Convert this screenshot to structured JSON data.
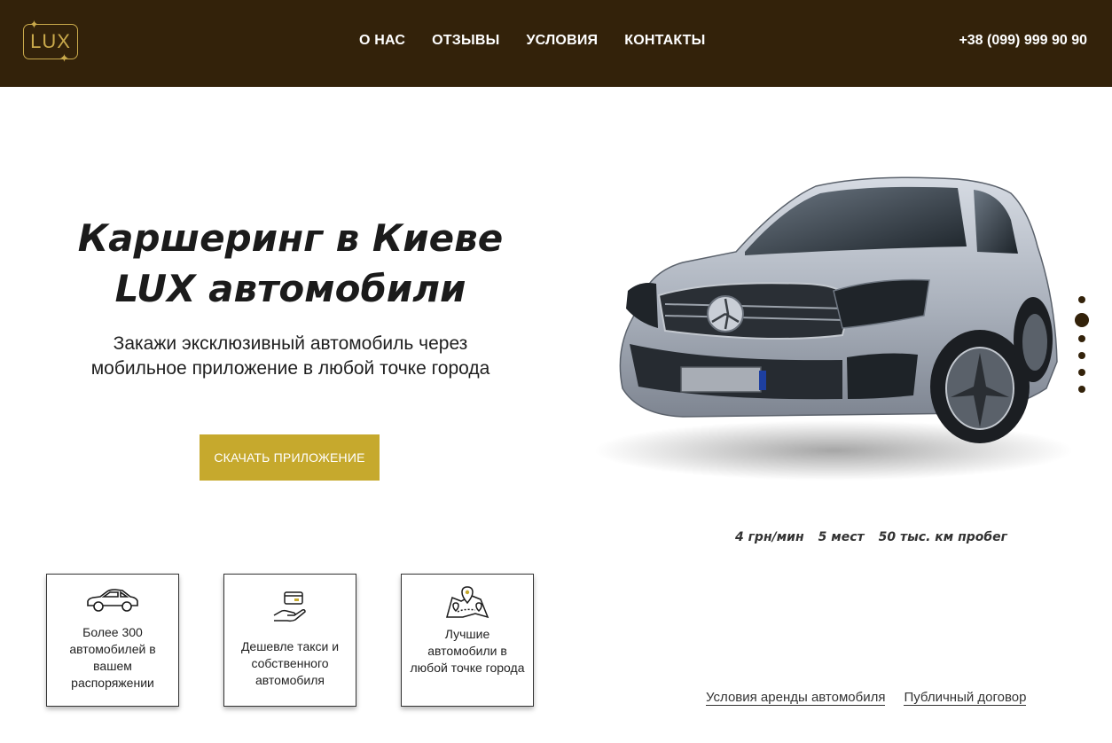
{
  "header": {
    "logo_text": "LUX",
    "nav": [
      "О НАС",
      "ОТЗЫВЫ",
      "УСЛОВИЯ",
      "КОНТАКТЫ"
    ],
    "phone": "+38 (099) 999 90 90"
  },
  "hero": {
    "title_line1": "Каршеринг в Киеве",
    "title_line2": "LUX автомобили",
    "subtitle_line1": "Закажи эксклюзивный автомобиль через",
    "subtitle_line2": "мобильное приложение в любой точке города",
    "cta_label": "СКАЧАТЬ ПРИЛОЖЕНИЕ"
  },
  "car": {
    "specs": [
      "4 грн/мин",
      "5 мест",
      "50 тыс. км пробег"
    ]
  },
  "slider": {
    "dot_count": 6,
    "active_index": 1
  },
  "features": [
    {
      "icon": "car-icon",
      "text": "Более 300 автомобилей в вашем распоряжении"
    },
    {
      "icon": "hand-card-icon",
      "text": "Дешевле такси и собственного автомобиля"
    },
    {
      "icon": "map-pin-icon",
      "text": "Лучшие автомобили в любой точке города"
    }
  ],
  "footer_links": [
    "Условия аренды автомобиля",
    "Публичный договор"
  ],
  "colors": {
    "header_bg": "#33220a",
    "accent_gold": "#c6a92d",
    "logo_gold": "#c9a94b"
  }
}
